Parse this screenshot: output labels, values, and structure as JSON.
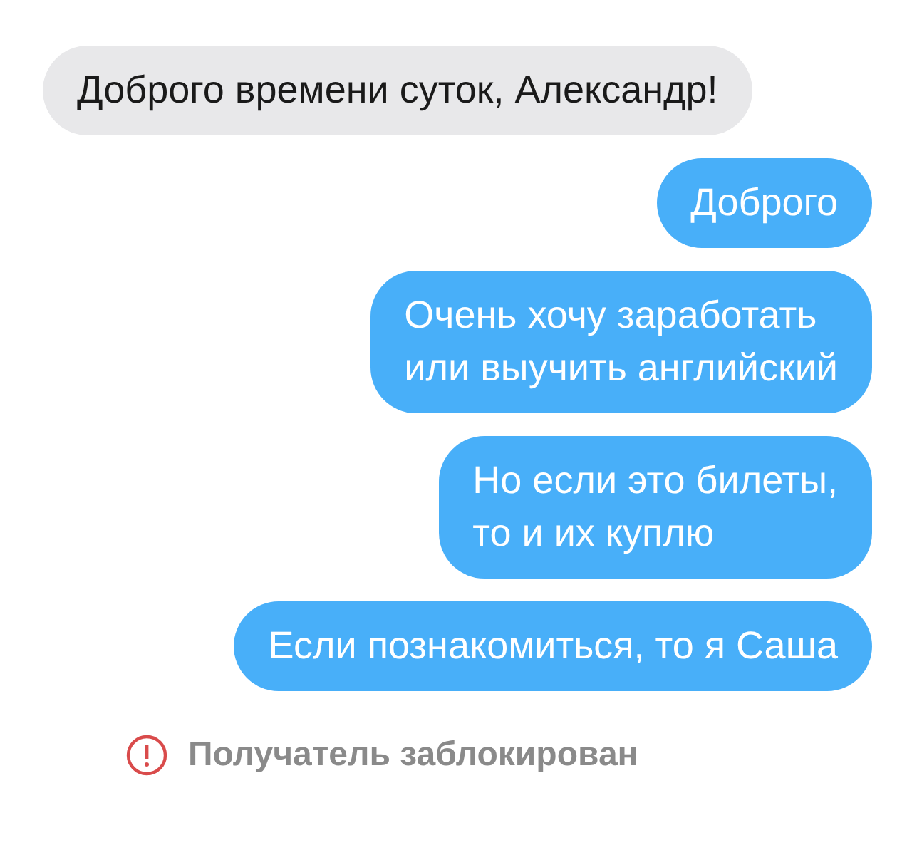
{
  "messages": [
    {
      "kind": "incoming",
      "lines": [
        "Доброго времени суток, Александр!"
      ]
    },
    {
      "kind": "outgoing",
      "lines": [
        "Доброго"
      ]
    },
    {
      "kind": "outgoing",
      "lines": [
        "Очень хочу заработать",
        "или выучить английский"
      ]
    },
    {
      "kind": "outgoing",
      "lines": [
        "Но если это билеты,",
        "то и их куплю"
      ]
    },
    {
      "kind": "outgoing",
      "lines": [
        "Если познакомиться, то я Саша"
      ]
    }
  ],
  "status": {
    "text": "Получатель заблокирован"
  }
}
